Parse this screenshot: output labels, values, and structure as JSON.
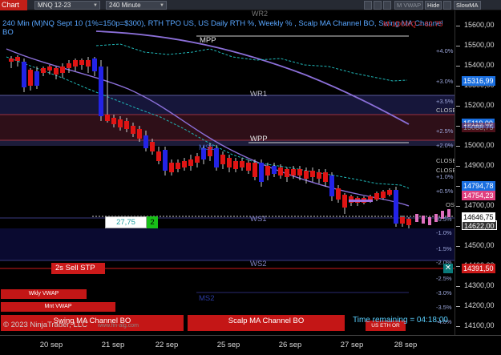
{
  "toolbar": {
    "chart_tab": "Chart",
    "instrument": "MNQ 12-23",
    "interval": "240 Minute",
    "vwap_btn": "M VWAP",
    "hide_btn": "Hide",
    "slowma_btn": "SlowMA"
  },
  "chart": {
    "title": "240 Min (M)NQ Sept 10 (1%=150p=$300), RTH TPO US, US Daily RTH %, Weekly % , Scalp MA Channel BO, Swing MA Channel BO",
    "top_right_readout": "M-1D00/Q = 62.75",
    "copyright": "© 2023 NinjaTrader, LLC",
    "watermark_url": "www.fin-alg.com",
    "time_remaining": "Time remaining = 04:18:00",
    "levels": {
      "wr2": "WR2",
      "mpp": "MPP",
      "wr1": "WR1",
      "wpp": "WPP",
      "ms1": "MS1",
      "ws1": "WS1",
      "ws2": "WS2",
      "ms2": "MS2"
    },
    "position": {
      "value": "27,75",
      "quantity": "2",
      "order": "2s  Sell STP"
    },
    "buttons": {
      "wkly_vwap": "Wkly VWAP",
      "mnt_vwap": "Mnt VWAP",
      "swing_ma": "Swing MA Channel BO",
      "scalp_ma": "Scalp MA Channel BO",
      "us_eth": "US ETH OR"
    },
    "right_labels": {
      "close1": "CLOSE",
      "close2": "CLOSE",
      "close3": "CLOSE",
      "ose": "OSE",
      "pct_plus_40": "+4.0%",
      "pct_plus_30": "+3.0%",
      "pct_plus_35": "+3.5%",
      "pct_plus_25": "+2.5%",
      "pct_plus_20": "+2.0%",
      "pct_plus_15": "+1.5%",
      "pct_plus_10": "+1.0%",
      "pct_plus_05": "+0.5%",
      "pct_zero": "0.0%",
      "pct_minus_05": "-0.5%",
      "pct_minus_10": "-1.0%",
      "pct_minus_15": "-1.5%",
      "pct_minus_20": "-2.0%",
      "pct_minus_25": "-2.5%",
      "pct_minus_30": "-3.0%",
      "pct_minus_35": "-3.5%",
      "pct_minus_40": "-4.0%"
    }
  },
  "price_axis": {
    "ticks": [
      "15600,00",
      "15500,00",
      "15400,00",
      "15300,00",
      "15200,00",
      "15100,00",
      "15000,00",
      "14900,00",
      "14800,00",
      "14700,00",
      "14600,00",
      "14500,00",
      "14400,00",
      "14300,00",
      "14200,00",
      "14100,00"
    ],
    "badges": {
      "mpp": "15316,99",
      "wpp": "15119,00",
      "wr1": "15088,75",
      "b1": "14794,78",
      "b2": "14754,23",
      "last": "14646,75",
      "ws1": "14622,00",
      "stop": "14391,50"
    }
  },
  "date_axis": [
    "20 sep",
    "21 sep",
    "22 sep",
    "25 sep",
    "26 sep",
    "27 sep",
    "28 sep"
  ],
  "colors": {
    "bull_body": "#2323e6",
    "bear_body": "#e01414",
    "slow_ma": "#8b6fd8",
    "fast_ma": "#20b8b8",
    "sell_stop": "#cc1a1a",
    "price_badge": "#1a6fe0"
  }
}
